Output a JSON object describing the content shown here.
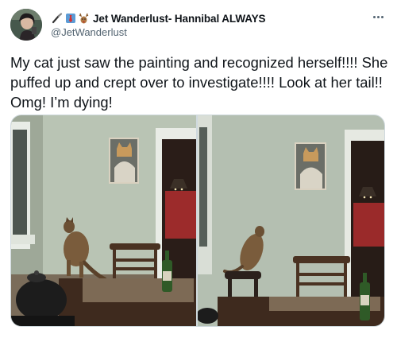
{
  "author": {
    "display_name": "Jet Wanderlust- Hannibal ALWAYS",
    "handle": "@JetWanderlust",
    "name_emojis": [
      "paintbrush-icon",
      "red-tie-icon",
      "deer-icon"
    ]
  },
  "tweet": {
    "text": "My cat just saw the painting and recognized herself!!!! She puffed up and crept over to investigate!!!! Look at her tail!! Omg! I’m dying!"
  },
  "media": {
    "photos": [
      {
        "subject": "cat-approaching-painting",
        "position": "left"
      },
      {
        "subject": "cat-investigating-painting",
        "position": "right"
      }
    ]
  },
  "colors": {
    "text": "#0f1419",
    "secondary": "#536471",
    "wall": "#b7c2b3",
    "border": "#cfd9de"
  }
}
